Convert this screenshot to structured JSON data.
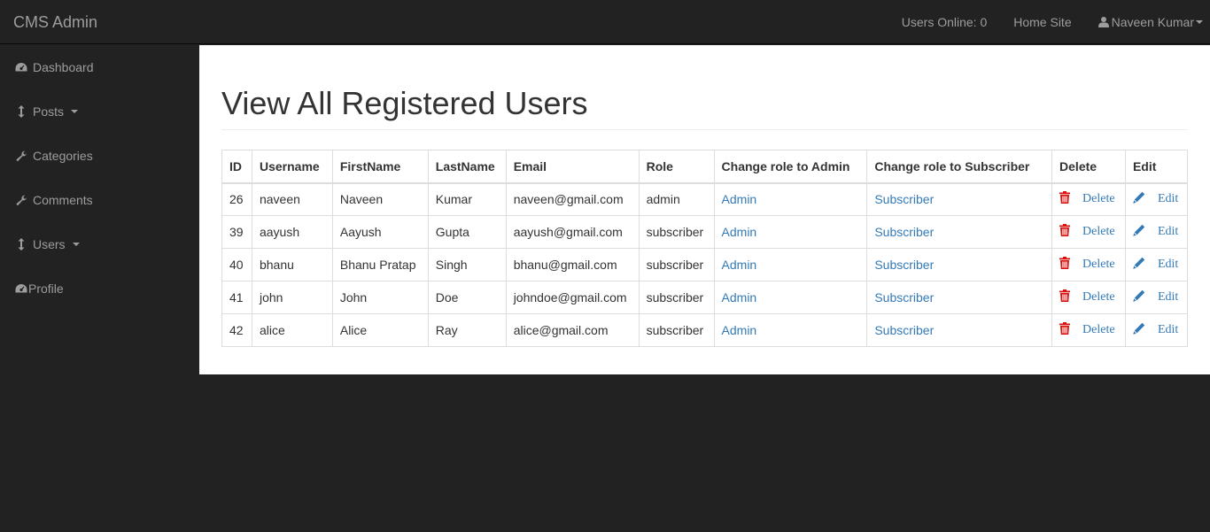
{
  "app": {
    "brand": "CMS Admin"
  },
  "topnav": {
    "users_online": "Users Online: 0",
    "home_site": "Home Site",
    "user_name": "Naveen Kumar"
  },
  "sidebar": {
    "items": [
      {
        "label": "Dashboard",
        "icon": "dashboard-icon"
      },
      {
        "label": "Posts",
        "icon": "vertical-arrows-icon",
        "dropdown": true
      },
      {
        "label": "Categories",
        "icon": "wrench-icon"
      },
      {
        "label": "Comments",
        "icon": "wrench-icon"
      },
      {
        "label": "Users",
        "icon": "vertical-arrows-icon",
        "dropdown": true
      },
      {
        "label": "Profile",
        "icon": "dashboard-icon"
      }
    ]
  },
  "main": {
    "title": "View All Registered Users",
    "table": {
      "headers": [
        "ID",
        "Username",
        "FirstName",
        "LastName",
        "Email",
        "Role",
        "Change role to Admin",
        "Change role to Subscriber",
        "Delete",
        "Edit"
      ],
      "admin_link": "Admin",
      "subscriber_link": "Subscriber",
      "delete_label": "Delete",
      "edit_label": "Edit",
      "rows": [
        {
          "id": "26",
          "username": "naveen",
          "firstname": "Naveen",
          "lastname": "Kumar",
          "email": "naveen@gmail.com",
          "role": "admin"
        },
        {
          "id": "39",
          "username": "aayush",
          "firstname": "Aayush",
          "lastname": "Gupta",
          "email": "aayush@gmail.com",
          "role": "subscriber"
        },
        {
          "id": "40",
          "username": "bhanu",
          "firstname": "Bhanu Pratap",
          "lastname": "Singh",
          "email": "bhanu@gmail.com",
          "role": "subscriber"
        },
        {
          "id": "41",
          "username": "john",
          "firstname": "John",
          "lastname": "Doe",
          "email": "johndoe@gmail.com",
          "role": "subscriber"
        },
        {
          "id": "42",
          "username": "alice",
          "firstname": "Alice",
          "lastname": "Ray",
          "email": "alice@gmail.com",
          "role": "subscriber"
        }
      ]
    }
  },
  "colors": {
    "navbar_bg": "#222222",
    "nav_text": "#9d9d9d",
    "link": "#337ab7",
    "delete": "#d9110e"
  }
}
